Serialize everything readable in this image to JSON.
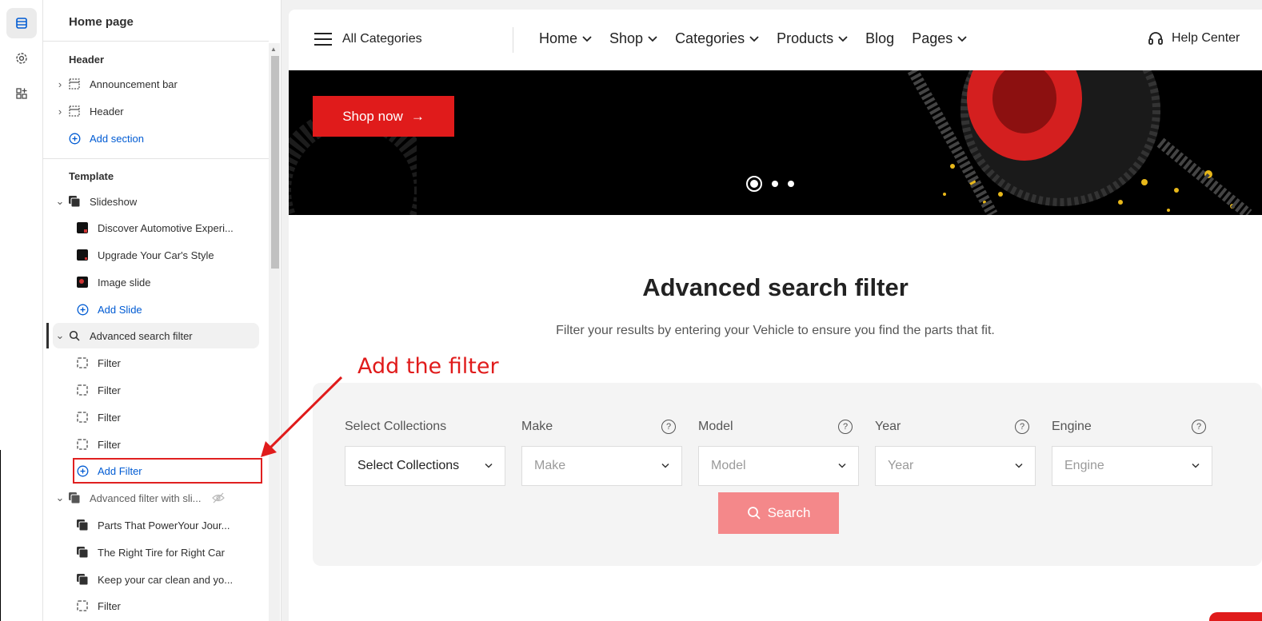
{
  "sidebar": {
    "title": "Home page",
    "header_heading": "Header",
    "header_items": [
      {
        "label": "Announcement bar"
      },
      {
        "label": "Header"
      }
    ],
    "add_section": "Add section",
    "template_heading": "Template",
    "slideshow": {
      "label": "Slideshow",
      "slides": [
        "Discover Automotive Experi...",
        "Upgrade Your Car's Style",
        "Image slide"
      ],
      "add_slide": "Add Slide"
    },
    "advanced_search": {
      "label": "Advanced search filter",
      "filters": [
        "Filter",
        "Filter",
        "Filter",
        "Filter"
      ],
      "add_filter": "Add Filter"
    },
    "advanced_slider": {
      "label": "Advanced filter with sli...",
      "items": [
        "Parts That PowerYour Jour...",
        "The Right Tire for Right Car",
        "Keep your car clean and yo..."
      ],
      "filter": "Filter"
    }
  },
  "annotation": "Add the filter",
  "site": {
    "all_categories": "All Categories",
    "nav": [
      {
        "label": "Home",
        "dropdown": true
      },
      {
        "label": "Shop",
        "dropdown": true
      },
      {
        "label": "Categories",
        "dropdown": true
      },
      {
        "label": "Products",
        "dropdown": true
      },
      {
        "label": "Blog",
        "dropdown": false
      },
      {
        "label": "Pages",
        "dropdown": true
      }
    ],
    "help": "Help Center",
    "hero": {
      "button": "Shop now",
      "slide_count": 3,
      "active_slide": 1
    },
    "section": {
      "title": "Advanced search filter",
      "subtitle": "Filter your results by entering your Vehicle to ensure you find the parts that fit.",
      "fields": [
        {
          "label": "Select Collections",
          "value": "Select Collections",
          "help": false,
          "filled": true
        },
        {
          "label": "Make",
          "value": "Make",
          "help": true,
          "filled": false
        },
        {
          "label": "Model",
          "value": "Model",
          "help": true,
          "filled": false
        },
        {
          "label": "Year",
          "value": "Year",
          "help": true,
          "filled": false
        },
        {
          "label": "Engine",
          "value": "Engine",
          "help": true,
          "filled": false
        }
      ],
      "search": "Search"
    }
  },
  "colors": {
    "accent": "#e01b1b",
    "link": "#005bd3",
    "search_button": "#f4888a"
  }
}
